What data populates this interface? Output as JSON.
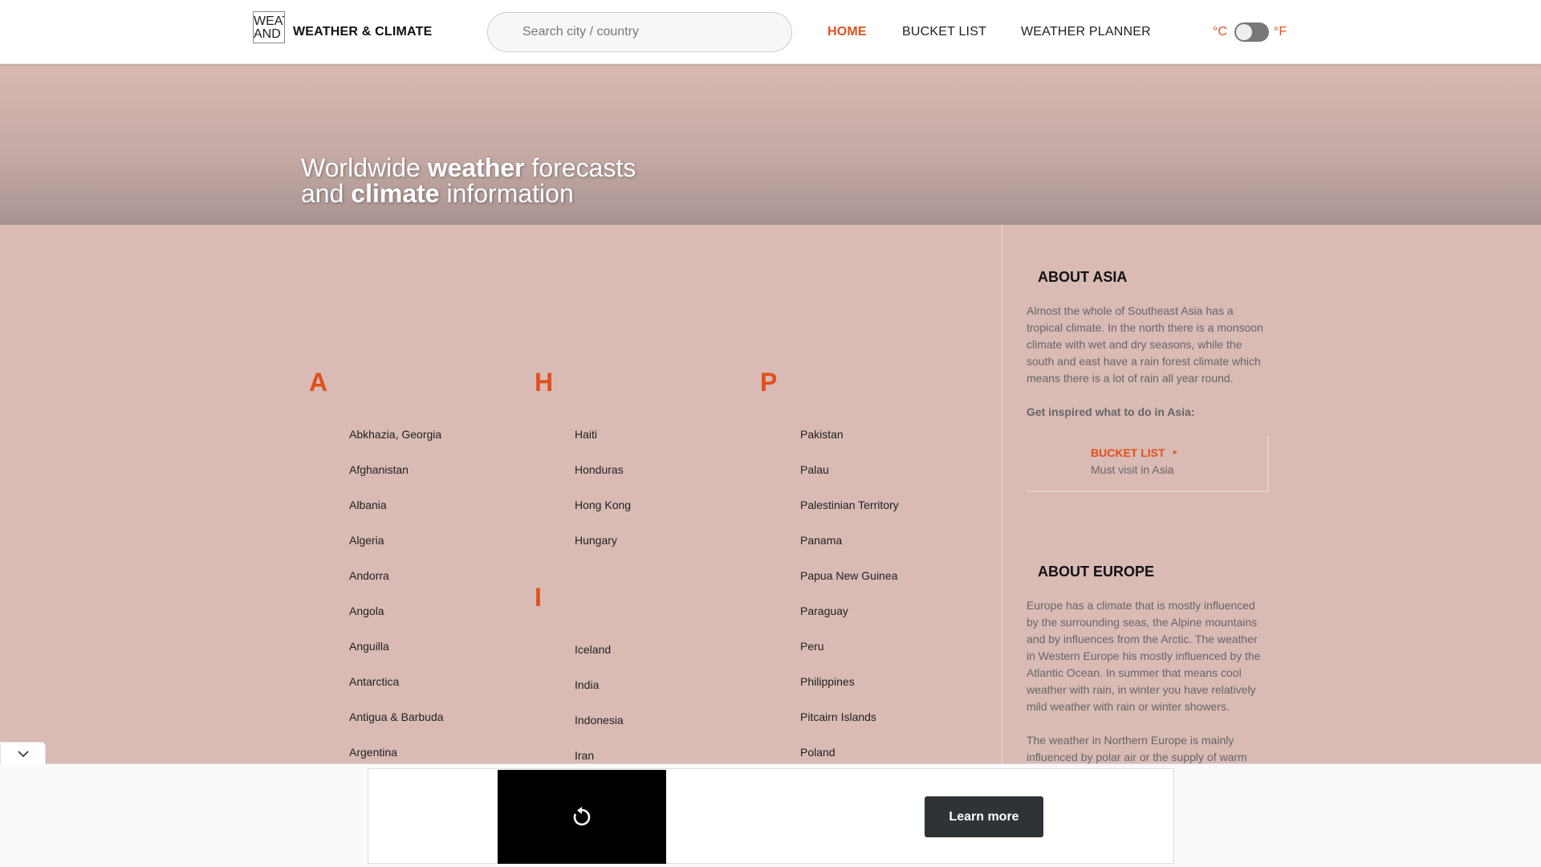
{
  "header": {
    "logo_alt": "WEATHER AND",
    "brand": "WEATHER & CLIMATE",
    "search_placeholder": "Search city / country",
    "nav": [
      {
        "label": "HOME",
        "active": true
      },
      {
        "label": "BUCKET LIST",
        "active": false
      },
      {
        "label": "WEATHER PLANNER",
        "active": false
      }
    ],
    "unit_c": "°C",
    "unit_f": "°F",
    "accent_color": "#e0501b"
  },
  "hero": {
    "line1_pre": "Worldwide ",
    "line1_bold": "weather",
    "line1_post": " forecasts",
    "line2_pre": "and ",
    "line2_bold": "climate",
    "line2_post": " information"
  },
  "countries": {
    "col1": {
      "letter": "A",
      "items": [
        "Abkhazia, Georgia",
        "Afghanistan",
        "Albania",
        "Algeria",
        "Andorra",
        "Angola",
        "Anguilla",
        "Antarctica",
        "Antigua & Barbuda",
        "Argentina"
      ]
    },
    "col2a": {
      "letter": "H",
      "items": [
        "Haiti",
        "Honduras",
        "Hong Kong",
        "Hungary"
      ]
    },
    "col2b": {
      "letter": "I",
      "items": [
        "Iceland",
        "India",
        "Indonesia",
        "Iran"
      ]
    },
    "col3": {
      "letter": "P",
      "items": [
        "Pakistan",
        "Palau",
        "Palestinian Territory",
        "Panama",
        "Papua New Guinea",
        "Paraguay",
        "Peru",
        "Philippines",
        "Pitcairn Islands",
        "Poland"
      ]
    }
  },
  "sidebar": {
    "asia_title": "ABOUT ASIA",
    "asia_text": "Almost the whole of Southeast Asia has a tropical climate. In the north there is a monsoon climate with wet and dry seasons, while the south and east have a rain forest climate which means there is a lot of rain all year round.",
    "inspire": "Get inspired what to do in Asia:",
    "bucket_link": "BUCKET LIST",
    "bucket_arrow": "▸",
    "bucket_sub": "Must visit in Asia",
    "europe_title": "ABOUT EUROPE",
    "europe_text": "Europe has a climate that is mostly influenced by the surrounding seas, the Alpine mountains and by influences from the Arctic. The weather in Western Europe his mostly influenced by the Atlantic Ocean. In summer that means cool weather with rain, in winter you have relatively mild weather with rain or winter showers.",
    "europe_text2": "The weather in Northern Europe is mainly influenced by polar air or the supply of warm"
  },
  "ad": {
    "learn_more": "Learn more"
  }
}
